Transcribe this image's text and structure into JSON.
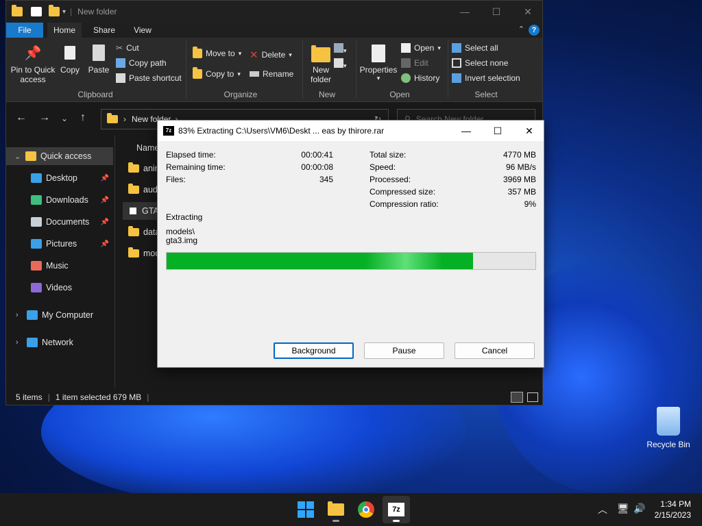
{
  "explorer": {
    "title": "New folder",
    "menu": {
      "file": "File",
      "home": "Home",
      "share": "Share",
      "view": "View"
    },
    "ribbon": {
      "clipboard": {
        "pin": [
          "Pin to Quick",
          "access"
        ],
        "copy": "Copy",
        "paste": "Paste",
        "cut": "Cut",
        "copy_path": "Copy path",
        "paste_shortcut": "Paste shortcut",
        "group": "Clipboard"
      },
      "organize": {
        "move_to": "Move to",
        "copy_to": "Copy to",
        "delete": "Delete",
        "rename": "Rename",
        "group": "Organize"
      },
      "new": {
        "new_folder": [
          "New",
          "folder"
        ],
        "group": "New"
      },
      "open": {
        "properties": "Properties",
        "open": "Open",
        "edit": "Edit",
        "history": "History",
        "group": "Open"
      },
      "select": {
        "select_all": "Select all",
        "select_none": "Select none",
        "invert": "Invert selection",
        "group": "Select"
      }
    },
    "address": {
      "path": "New folder",
      "search_placeholder": "Search New folder"
    },
    "nav": [
      {
        "label": "Quick access",
        "icon": "star-icon",
        "color": "#f5c242",
        "selected": true
      },
      {
        "label": "Desktop",
        "icon": "desktop-icon",
        "color": "#3aa0e8",
        "pinned": true
      },
      {
        "label": "Downloads",
        "icon": "download-icon",
        "color": "#3fbf7f",
        "pinned": true
      },
      {
        "label": "Documents",
        "icon": "documents-icon",
        "color": "#c8d0d8",
        "pinned": true
      },
      {
        "label": "Pictures",
        "icon": "pictures-icon",
        "color": "#3aa0e8",
        "pinned": true
      },
      {
        "label": "Music",
        "icon": "music-icon",
        "color": "#e86a5a"
      },
      {
        "label": "Videos",
        "icon": "videos-icon",
        "color": "#8b6ad8"
      },
      {
        "label": "My Computer",
        "icon": "computer-icon",
        "color": "#3aa0e8"
      },
      {
        "label": "Network",
        "icon": "network-icon",
        "color": "#3aa0e8"
      }
    ],
    "column_header": "Name",
    "files": [
      {
        "name": "anim",
        "type": "folder"
      },
      {
        "name": "audi",
        "type": "folder"
      },
      {
        "name": "GTA",
        "type": "app",
        "selected": true
      },
      {
        "name": "data",
        "type": "folder"
      },
      {
        "name": "mod",
        "type": "folder"
      }
    ],
    "status": {
      "items": "5 items",
      "selected": "1 item selected  679 MB"
    }
  },
  "dialog": {
    "title": "83% Extracting C:\\Users\\VM6\\Deskt ... eas by thirore.rar",
    "left": [
      {
        "label": "Elapsed time:",
        "value": "00:00:41"
      },
      {
        "label": "Remaining time:",
        "value": "00:00:08"
      },
      {
        "label": "Files:",
        "value": "345"
      }
    ],
    "right": [
      {
        "label": "Total size:",
        "value": "4770 MB"
      },
      {
        "label": "Speed:",
        "value": "96 MB/s"
      },
      {
        "label": "Processed:",
        "value": "3969 MB"
      },
      {
        "label": "Compressed size:",
        "value": "357 MB"
      },
      {
        "label": "Compression ratio:",
        "value": "9%"
      }
    ],
    "action": "Extracting",
    "current_path": "models\\",
    "current_file": "gta3.img",
    "progress": 0.83,
    "buttons": {
      "background": "Background",
      "pause": "Pause",
      "cancel": "Cancel"
    }
  },
  "desktop": {
    "recycle_bin": "Recycle Bin"
  },
  "taskbar": {
    "time": "1:34 PM",
    "date": "2/15/2023",
    "app_7z": "7z"
  }
}
